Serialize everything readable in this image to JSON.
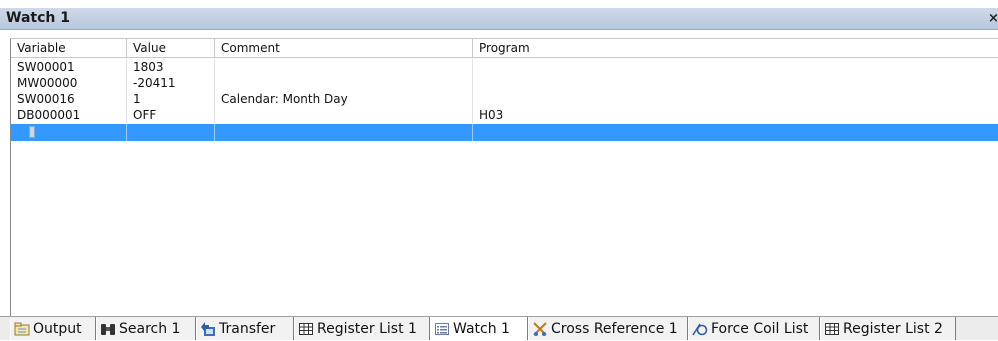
{
  "window": {
    "title": "Watch 1",
    "close_glyph": "×"
  },
  "grid": {
    "columns": [
      "Variable",
      "Value",
      "Comment",
      "Program"
    ],
    "rows": [
      {
        "variable": "SW00001",
        "value": "1803",
        "comment": "",
        "program": ""
      },
      {
        "variable": "MW00000",
        "value": "-20411",
        "comment": "",
        "program": ""
      },
      {
        "variable": "SW00016",
        "value": "1",
        "comment": "Calendar: Month Day",
        "program": ""
      },
      {
        "variable": "DB000001",
        "value": "OFF",
        "comment": "",
        "program": "H03"
      }
    ],
    "selected_row_color": "#3399ff"
  },
  "tabs": [
    {
      "label": "Output",
      "icon": "output-icon"
    },
    {
      "label": "Search 1",
      "icon": "binoculars-icon"
    },
    {
      "label": "Transfer",
      "icon": "transfer-icon"
    },
    {
      "label": "Register List 1",
      "icon": "grid-icon"
    },
    {
      "label": "Watch 1",
      "icon": "list-icon",
      "active": true
    },
    {
      "label": "Cross Reference 1",
      "icon": "cross-reference-icon"
    },
    {
      "label": "Force Coil List",
      "icon": "coil-icon"
    },
    {
      "label": "Register List 2",
      "icon": "grid-icon"
    }
  ]
}
